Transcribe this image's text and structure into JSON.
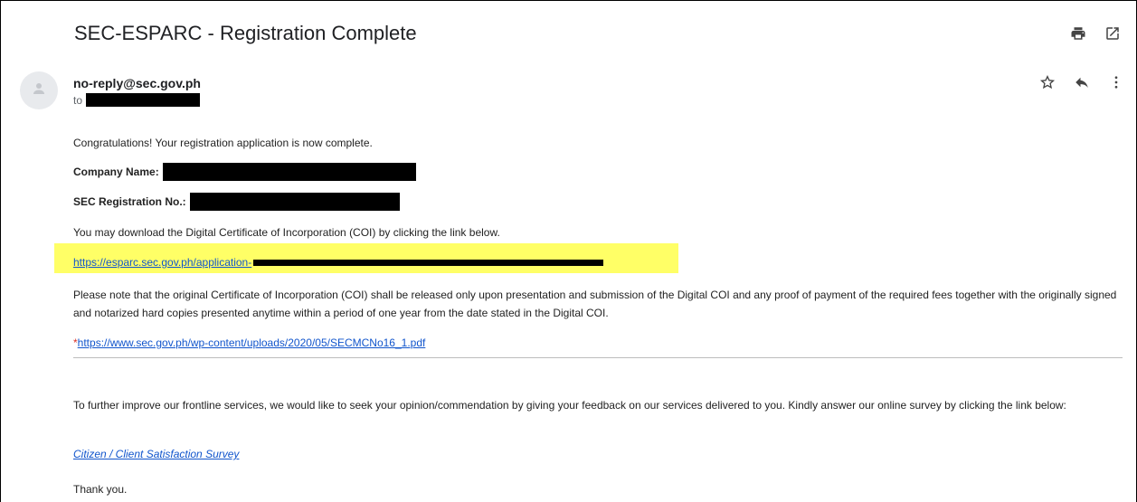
{
  "email": {
    "subject": "SEC-ESPARC - Registration Complete",
    "sender": "no-reply@sec.gov.ph",
    "to_label": "to"
  },
  "icons": {
    "print": "print-icon",
    "open_new": "open-in-new-icon",
    "star": "star-icon",
    "reply": "reply-icon",
    "more": "more-vert-icon",
    "avatar": "person-icon"
  },
  "body": {
    "congrats": "Congratulations! Your registration application is now complete.",
    "company_label": "Company Name:",
    "sec_reg_label": "SEC Registration No.:",
    "download_text": "You may download the Digital Certificate of Incorporation (COI) by clicking the link below.",
    "coi_link_visible": "https://esparc.sec.gov.ph/application-",
    "note": "Please note that the original Certificate of Incorporation (COI) shall be released only upon presentation and submission of the Digital COI and any proof of payment of the required fees together with the originally signed and notarized hard copies presented anytime within a period of one year from the date stated in the Digital COI.",
    "memo_asterisk": "*",
    "memo_link": "https://www.sec.gov.ph/wp-content/uploads/2020/05/SECMCNo16_1.pdf",
    "survey_text": "To further improve our frontline services, we would like to seek your opinion/commendation by giving your feedback on our services delivered to you. Kindly answer our online survey by clicking the link below:",
    "survey_link": "Citizen / Client Satisfaction Survey",
    "thanks": "Thank you."
  },
  "colors": {
    "highlight": "#ffff66",
    "link": "#1155cc",
    "redaction": "#000000"
  }
}
